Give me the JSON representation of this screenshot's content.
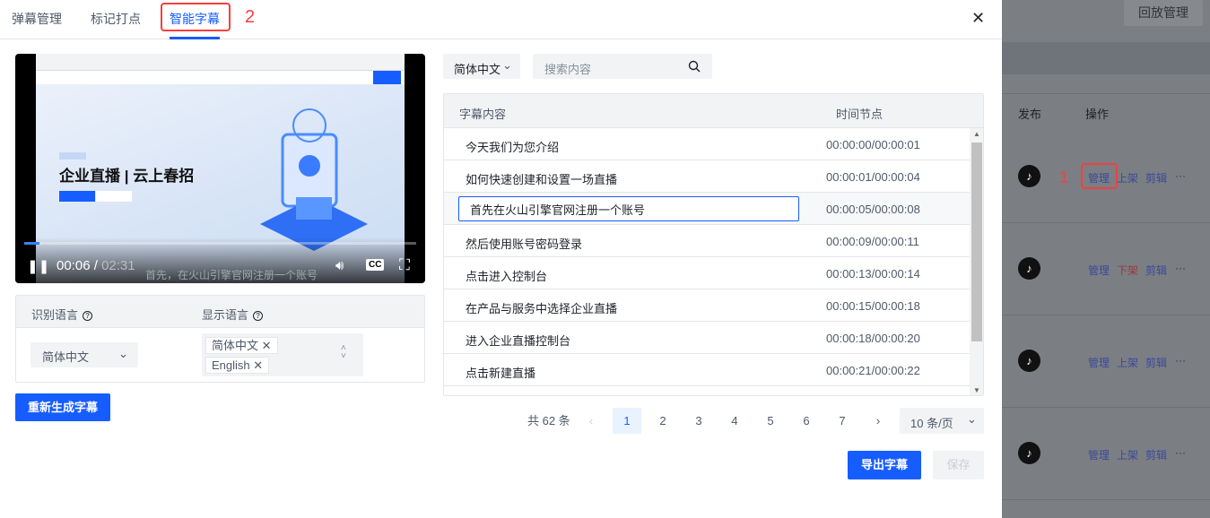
{
  "tabs": [
    {
      "label": "弹幕管理"
    },
    {
      "label": "标记打点"
    },
    {
      "label": "智能字幕"
    }
  ],
  "annotations": {
    "step1": "1",
    "step2": "2"
  },
  "video": {
    "hero_text": "企业直播 | 云上春招",
    "current_time": "00:06",
    "separator": "/",
    "duration": "02:31",
    "subtitle": "首先，在火山引擎官网注册一个账号",
    "progress_percent": 4,
    "cc_label": "CC"
  },
  "settings": {
    "recognize_label": "识别语言",
    "display_label": "显示语言",
    "recognize_value": "简体中文",
    "display_tags": [
      "简体中文",
      "English"
    ],
    "help_glyph": "?"
  },
  "regenerate_label": "重新生成字幕",
  "filter": {
    "language": "简体中文",
    "search_placeholder": "搜索内容"
  },
  "table": {
    "col_content": "字幕内容",
    "col_time": "时间节点",
    "rows": [
      {
        "content": "今天我们为您介绍",
        "time": "00:00:00/00:00:01"
      },
      {
        "content": "如何快速创建和设置一场直播",
        "time": "00:00:01/00:00:04"
      },
      {
        "content": "首先在火山引擎官网注册一个账号",
        "time": "00:00:05/00:00:08"
      },
      {
        "content": "然后使用账号密码登录",
        "time": "00:00:09/00:00:11"
      },
      {
        "content": "点击进入控制台",
        "time": "00:00:13/00:00:14"
      },
      {
        "content": "在产品与服务中选择企业直播",
        "time": "00:00:15/00:00:18"
      },
      {
        "content": "进入企业直播控制台",
        "time": "00:00:18/00:00:20"
      },
      {
        "content": "点击新建直播",
        "time": "00:00:21/00:00:22"
      }
    ]
  },
  "pagination": {
    "total": "共 62 条",
    "pages": [
      "1",
      "2",
      "3",
      "4",
      "5",
      "6",
      "7"
    ],
    "current": "1",
    "page_size": "10 条/页"
  },
  "export_label": "导出字幕",
  "save_label": "保存",
  "background": {
    "replay_button": "回放管理",
    "col_publish": "发布",
    "col_action": "操作",
    "rows": [
      {
        "manage": "管理",
        "shelf": "上架",
        "edit": "剪辑",
        "more": "···"
      },
      {
        "manage": "管理",
        "shelf": "下架",
        "edit": "剪辑",
        "more": "···"
      },
      {
        "manage": "管理",
        "shelf": "上架",
        "edit": "剪辑",
        "more": "···"
      },
      {
        "manage": "管理",
        "shelf": "上架",
        "edit": "剪辑",
        "more": "···"
      }
    ]
  },
  "colors": {
    "primary": "#165dff",
    "highlight": "#f53f3f",
    "overlay": "#7b7e83"
  }
}
